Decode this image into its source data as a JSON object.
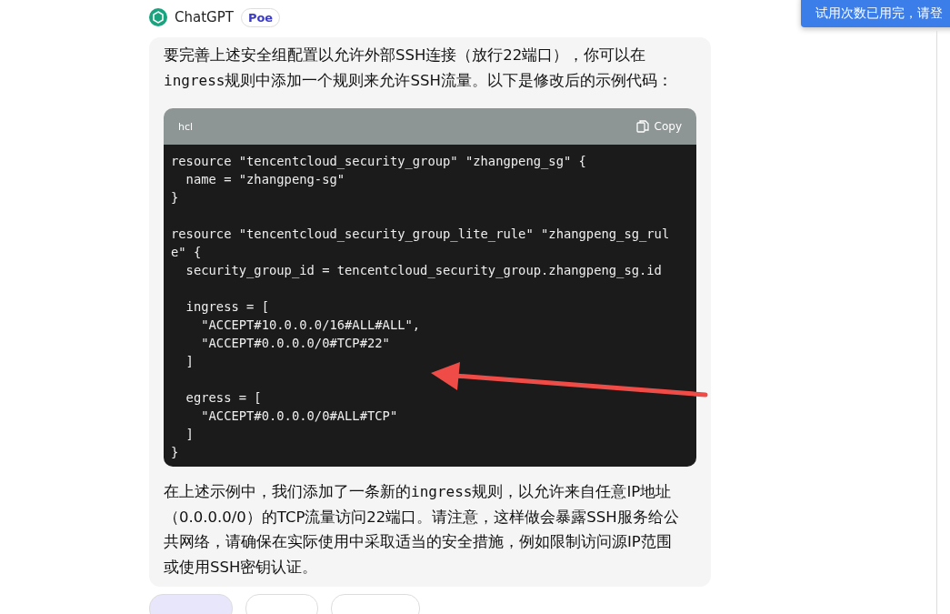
{
  "bot": {
    "name": "ChatGPT",
    "badge": "Poe"
  },
  "toast": {
    "text": "试用次数已用完，请登"
  },
  "message": {
    "intro": [
      {
        "kind": "text",
        "text": "要完善上述安全组配置以允许外部SSH连接（放行22端口），你可以在"
      },
      {
        "kind": "code",
        "text": "ingress"
      },
      {
        "kind": "text",
        "text": "规则中添加一个规则来允许SSH流量。以下是修改后的示例代码："
      }
    ],
    "code_block": {
      "language": "hcl",
      "copy_label": "Copy",
      "sections": [
        [
          "resource \"tencentcloud_security_group\" \"zhangpeng_sg\" {",
          "  name = \"zhangpeng-sg\"",
          "}"
        ],
        [
          "resource \"tencentcloud_security_group_lite_rule\" \"zhangpeng_sg_rul",
          "e\" {",
          "  security_group_id = tencentcloud_security_group.zhangpeng_sg.id"
        ],
        [
          "  ingress = [",
          "    \"ACCEPT#10.0.0.0/16#ALL#ALL\",",
          "    \"ACCEPT#0.0.0.0/0#TCP#22\"",
          "  ]"
        ],
        [
          "  egress = [",
          "    \"ACCEPT#0.0.0.0/0#ALL#TCP\"",
          "  ]",
          "}"
        ]
      ]
    },
    "outro": [
      {
        "kind": "text",
        "text": "在上述示例中，我们添加了一条新的"
      },
      {
        "kind": "code",
        "text": "ingress"
      },
      {
        "kind": "text",
        "text": "规则，以允许来自任意IP地址（0.0.0.0/0）的TCP流量访问22端口。请注意，这样做会暴露SSH服务给公共网络，请确保在实际使用中采取适当的安全措施，例如限制访问源IP范围或使用SSH密钥认证。"
      }
    ]
  },
  "actions": [
    {
      "selected": true
    },
    {
      "selected": false
    },
    {
      "selected": false
    }
  ]
}
